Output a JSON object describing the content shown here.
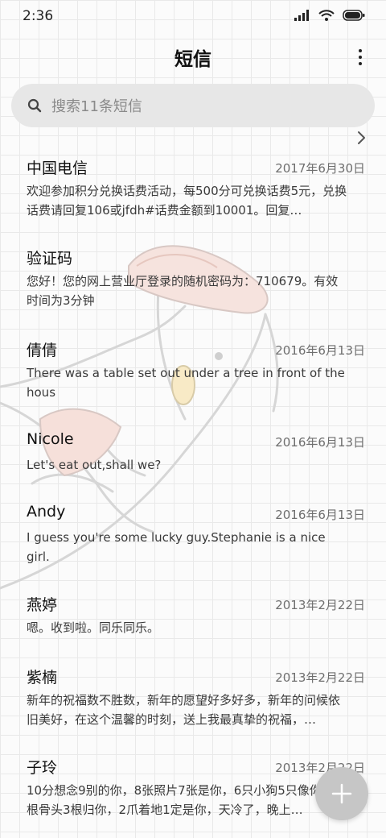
{
  "status": {
    "time": "2:36"
  },
  "header": {
    "title": "短信",
    "more_icon": "more-vert-icon"
  },
  "search": {
    "placeholder": "搜索11条短信",
    "icon": "search-icon"
  },
  "messages": [
    {
      "name": "中国电信",
      "date": "2017年6月30日",
      "body": "欢迎参加积分兑换话费活动，每500分可兑换话费5元，兑换话费请回复106或jfdh#话费金额到10001。回复…"
    },
    {
      "name": "验证码",
      "date": "",
      "body": "您好！您的网上营业厅登录的随机密码为：710679。有效时间为3分钟"
    },
    {
      "name": "倩倩",
      "date": "2016年6月13日",
      "body": "There was a table set out under a tree in front of the hous"
    },
    {
      "name": "Nicole",
      "date": "2016年6月13日",
      "body": "Let's eat out,shall we?"
    },
    {
      "name": "Andy",
      "date": "2016年6月13日",
      "body": "I guess you're some lucky guy.Stephanie is a nice girl."
    },
    {
      "name": "燕婷",
      "date": "2013年2月22日",
      "body": "嗯。收到啦。同乐同乐。"
    },
    {
      "name": "紫楠",
      "date": "2013年2月22日",
      "body": "新年的祝福数不胜数，新年的愿望好多好多，新年的问候依旧美好，在这个温馨的时刻，送上我最真挚的祝福，…"
    },
    {
      "name": "子玲",
      "date": "2013年2月22日",
      "body": "10分想念9别的你，8张照片7张是你，6只小狗5只像你，4根骨头3根归你，2爪着地1定是你，天冷了，晚上…"
    }
  ],
  "fab": {
    "icon": "plus-icon"
  },
  "colors": {
    "background": "#fbfbfb",
    "grid": "#e9e9e9",
    "search_bg": "#e7e7e7",
    "fab": "#c6c6c6"
  }
}
